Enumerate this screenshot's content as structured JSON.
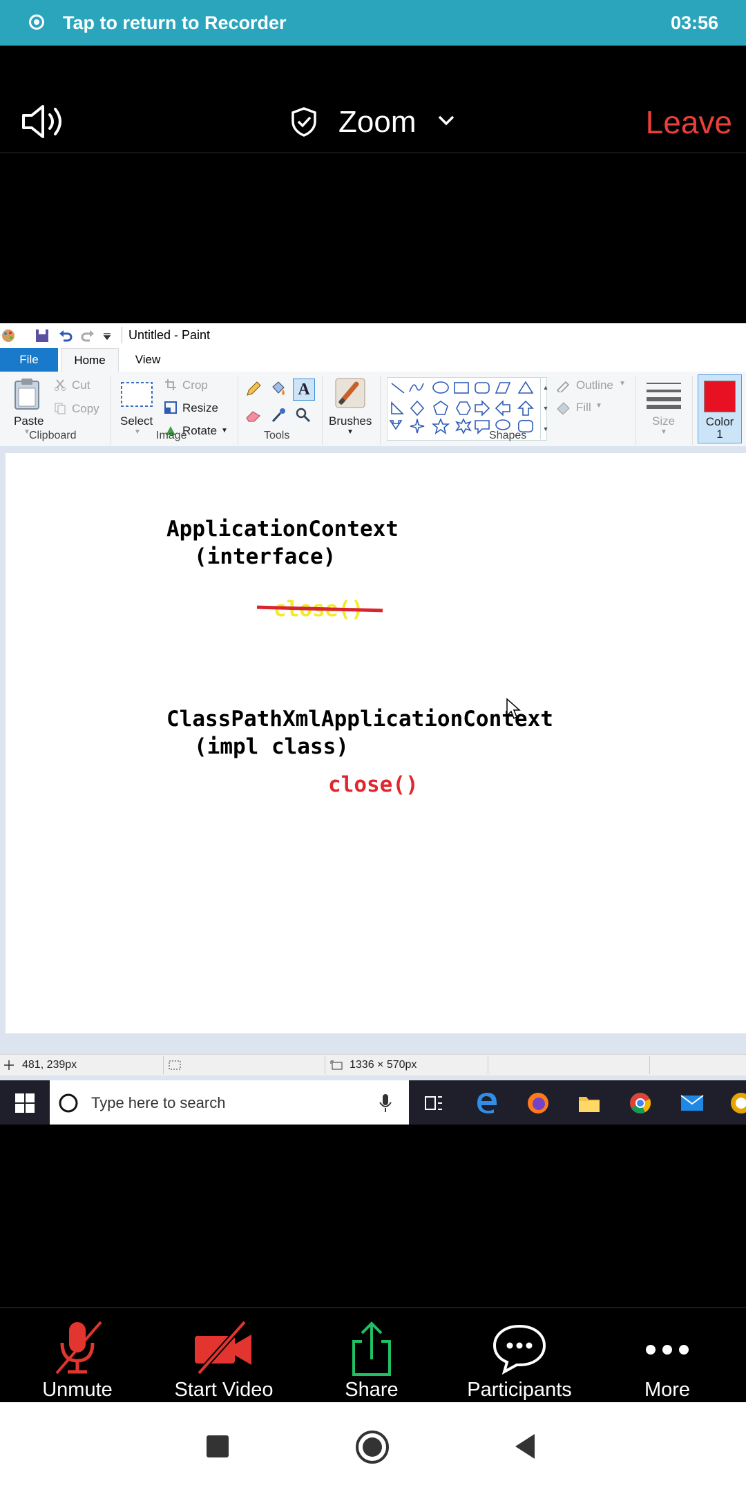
{
  "recorder_banner": {
    "text": "Tap to return to Recorder",
    "time": "03:56"
  },
  "meeting_header": {
    "title": "Zoom",
    "leave_label": "Leave"
  },
  "paint": {
    "window_title": "Untitled - Paint",
    "tabs": [
      "File",
      "Home",
      "View"
    ],
    "clipboard": {
      "paste": "Paste",
      "cut": "Cut",
      "copy": "Copy",
      "group": "Clipboard"
    },
    "image": {
      "select": "Select",
      "crop": "Crop",
      "resize": "Resize",
      "rotate": "Rotate",
      "group": "Image"
    },
    "tools_group": "Tools",
    "brushes": "Brushes",
    "shapes": {
      "outline": "Outline",
      "fill": "Fill",
      "group": "Shapes"
    },
    "size": "Size",
    "color": {
      "label": "Color",
      "number": "1",
      "value": "#e81123"
    },
    "canvas_text": {
      "line1": "ApplicationContext",
      "line2": "(interface)",
      "struck": "close()",
      "line3": "ClassPathXmlApplicationContext",
      "line4": "(impl class)",
      "close_red": "close()"
    },
    "status": {
      "cursor_pos": "481, 239px",
      "canvas_size": "1336 × 570px"
    }
  },
  "taskbar": {
    "search_placeholder": "Type here to search"
  },
  "bottom_bar": {
    "unmute": "Unmute",
    "start_video": "Start Video",
    "share": "Share",
    "participants": "Participants",
    "more": "More"
  },
  "colors": {
    "banner": "#2aa5bb",
    "leave": "#ea3f3a",
    "muted_red": "#e2352f",
    "share_green": "#1fc163"
  }
}
